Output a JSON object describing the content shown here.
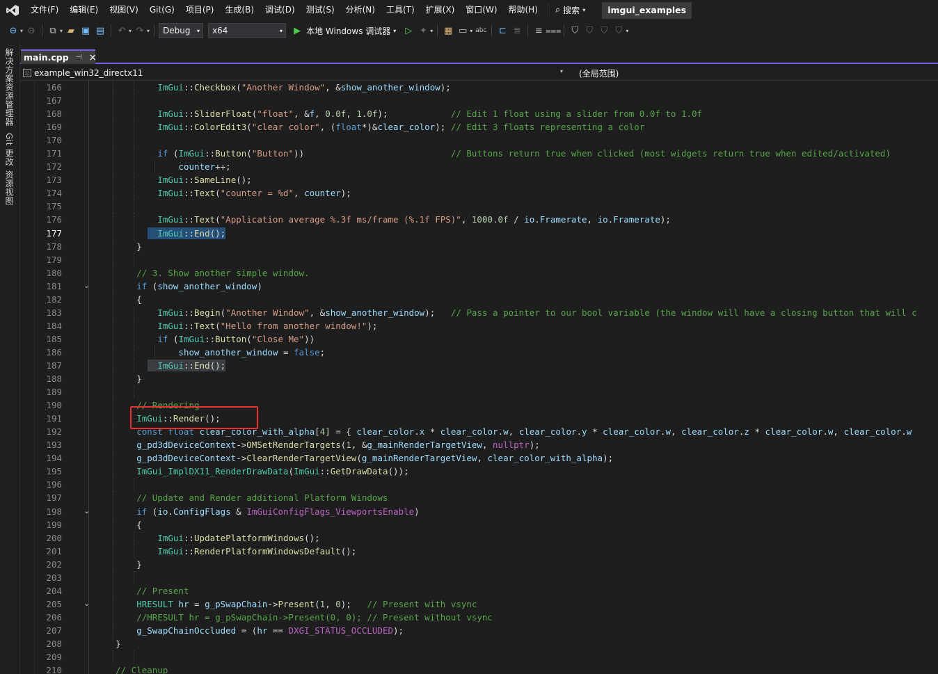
{
  "menu": {
    "items": [
      "文件(F)",
      "编辑(E)",
      "视图(V)",
      "Git(G)",
      "项目(P)",
      "生成(B)",
      "调试(D)",
      "测试(S)",
      "分析(N)",
      "工具(T)",
      "扩展(X)",
      "窗口(W)",
      "帮助(H)"
    ],
    "search_label": "搜索",
    "solution_name": "imgui_examples"
  },
  "toolbar": {
    "configuration": "Debug",
    "platform": "x64",
    "run_label": "本地 Windows 调试器"
  },
  "left_strip": {
    "tabs": [
      "解决方案资源管理器",
      "Git 更改",
      "资源视图"
    ]
  },
  "document_tab": {
    "file_name": "main.cpp"
  },
  "navigation": {
    "project": "example_win32_directx11",
    "scope": "(全局范围)"
  },
  "editor": {
    "current_line": 177,
    "line_numbers": [
      166,
      167,
      168,
      169,
      170,
      171,
      172,
      173,
      174,
      175,
      176,
      177,
      178,
      179,
      180,
      181,
      182,
      183,
      184,
      185,
      186,
      187,
      188,
      189,
      190,
      191,
      192,
      193,
      194,
      195,
      196,
      197,
      198,
      199,
      200,
      201,
      202,
      203,
      204,
      205,
      206,
      207,
      208,
      209,
      210
    ],
    "fold_markers_at_lines": [
      181,
      198,
      205
    ],
    "code_lines": [
      "            ImGui::Checkbox(\"Another Window\", &show_another_window);",
      "",
      "            ImGui::SliderFloat(\"float\", &f, 0.0f, 1.0f);            // Edit 1 float using a slider from 0.0f to 1.0f",
      "            ImGui::ColorEdit3(\"clear color\", (float*)&clear_color); // Edit 3 floats representing a color",
      "",
      "            if (ImGui::Button(\"Button\"))                            // Buttons return true when clicked (most widgets return true when edited/activated)",
      "                counter++;",
      "            ImGui::SameLine();",
      "            ImGui::Text(\"counter = %d\", counter);",
      "",
      "            ImGui::Text(\"Application average %.3f ms/frame (%.1f FPS)\", 1000.0f / io.Framerate, io.Framerate);",
      "            ImGui::End();",
      "        }",
      "",
      "        // 3. Show another simple window.",
      "        if (show_another_window)",
      "        {",
      "            ImGui::Begin(\"Another Window\", &show_another_window);   // Pass a pointer to our bool variable (the window will have a closing button that will c",
      "            ImGui::Text(\"Hello from another window!\");",
      "            if (ImGui::Button(\"Close Me\"))",
      "                show_another_window = false;",
      "            ImGui::End();",
      "        }",
      "",
      "        // Rendering",
      "        ImGui::Render();",
      "        const float clear_color_with_alpha[4] = { clear_color.x * clear_color.w, clear_color.y * clear_color.w, clear_color.z * clear_color.w, clear_color.w",
      "        g_pd3dDeviceContext->OMSetRenderTargets(1, &g_mainRenderTargetView, nullptr);",
      "        g_pd3dDeviceContext->ClearRenderTargetView(g_mainRenderTargetView, clear_color_with_alpha);",
      "        ImGui_ImplDX11_RenderDrawData(ImGui::GetDrawData());",
      "",
      "        // Update and Render additional Platform Windows",
      "        if (io.ConfigFlags & ImGuiConfigFlags_ViewportsEnable)",
      "        {",
      "            ImGui::UpdatePlatformWindows();",
      "            ImGui::RenderPlatformWindowsDefault();",
      "        }",
      "",
      "        // Present",
      "        HRESULT hr = g_pSwapChain->Present(1, 0);   // Present with vsync",
      "        //HRESULT hr = g_pSwapChain->Present(0, 0); // Present without vsync",
      "        g_SwapChainOccluded = (hr == DXGI_STATUS_OCCLUDED);",
      "    }",
      "",
      "    // Cleanup"
    ]
  }
}
